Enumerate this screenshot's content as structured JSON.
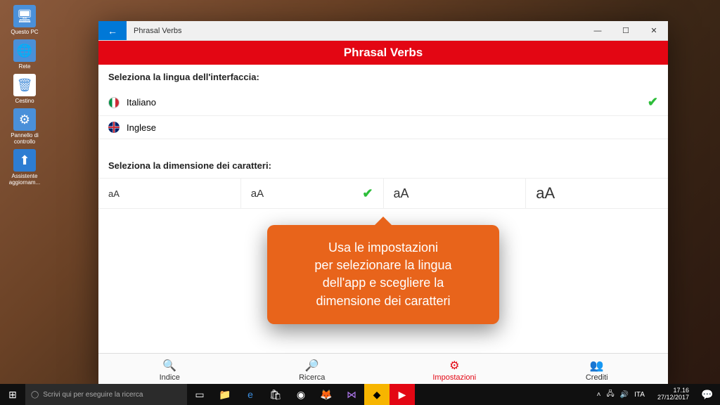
{
  "desktop": {
    "icons": [
      {
        "label": "Questo PC",
        "glyph": "🖥"
      },
      {
        "label": "Rete",
        "glyph": "🌐"
      },
      {
        "label": "Cestino",
        "glyph": "🗑"
      },
      {
        "label": "Pannello di controllo",
        "glyph": "⚙"
      },
      {
        "label": "Assistente aggiornam...",
        "glyph": "⬆"
      }
    ]
  },
  "window": {
    "title": "Phrasal Verbs",
    "header": "Phrasal Verbs"
  },
  "settings": {
    "lang_label": "Seleziona la lingua dell'interfaccia:",
    "languages": [
      {
        "name": "Italiano",
        "selected": true
      },
      {
        "name": "Inglese",
        "selected": false
      }
    ],
    "size_label": "Seleziona la dimensione dei caratteri:",
    "sizes": [
      "aA",
      "aA",
      "aA",
      "aA"
    ],
    "selected_size_index": 1
  },
  "callout": {
    "line1": "Usa le impostazioni",
    "line2": "per selezionare la lingua",
    "line3": "dell'app e scegliere la",
    "line4": "dimensione dei caratteri"
  },
  "nav": {
    "items": [
      {
        "label": "Indice",
        "icon": "🔍"
      },
      {
        "label": "Ricerca",
        "icon": "🔎"
      },
      {
        "label": "Impostazioni",
        "icon": "⚙"
      },
      {
        "label": "Crediti",
        "icon": "👥"
      }
    ],
    "active_index": 2
  },
  "taskbar": {
    "search_placeholder": "Scrivi qui per eseguire la ricerca",
    "lang": "ITA",
    "time": "17.16",
    "date": "27/12/2017"
  }
}
